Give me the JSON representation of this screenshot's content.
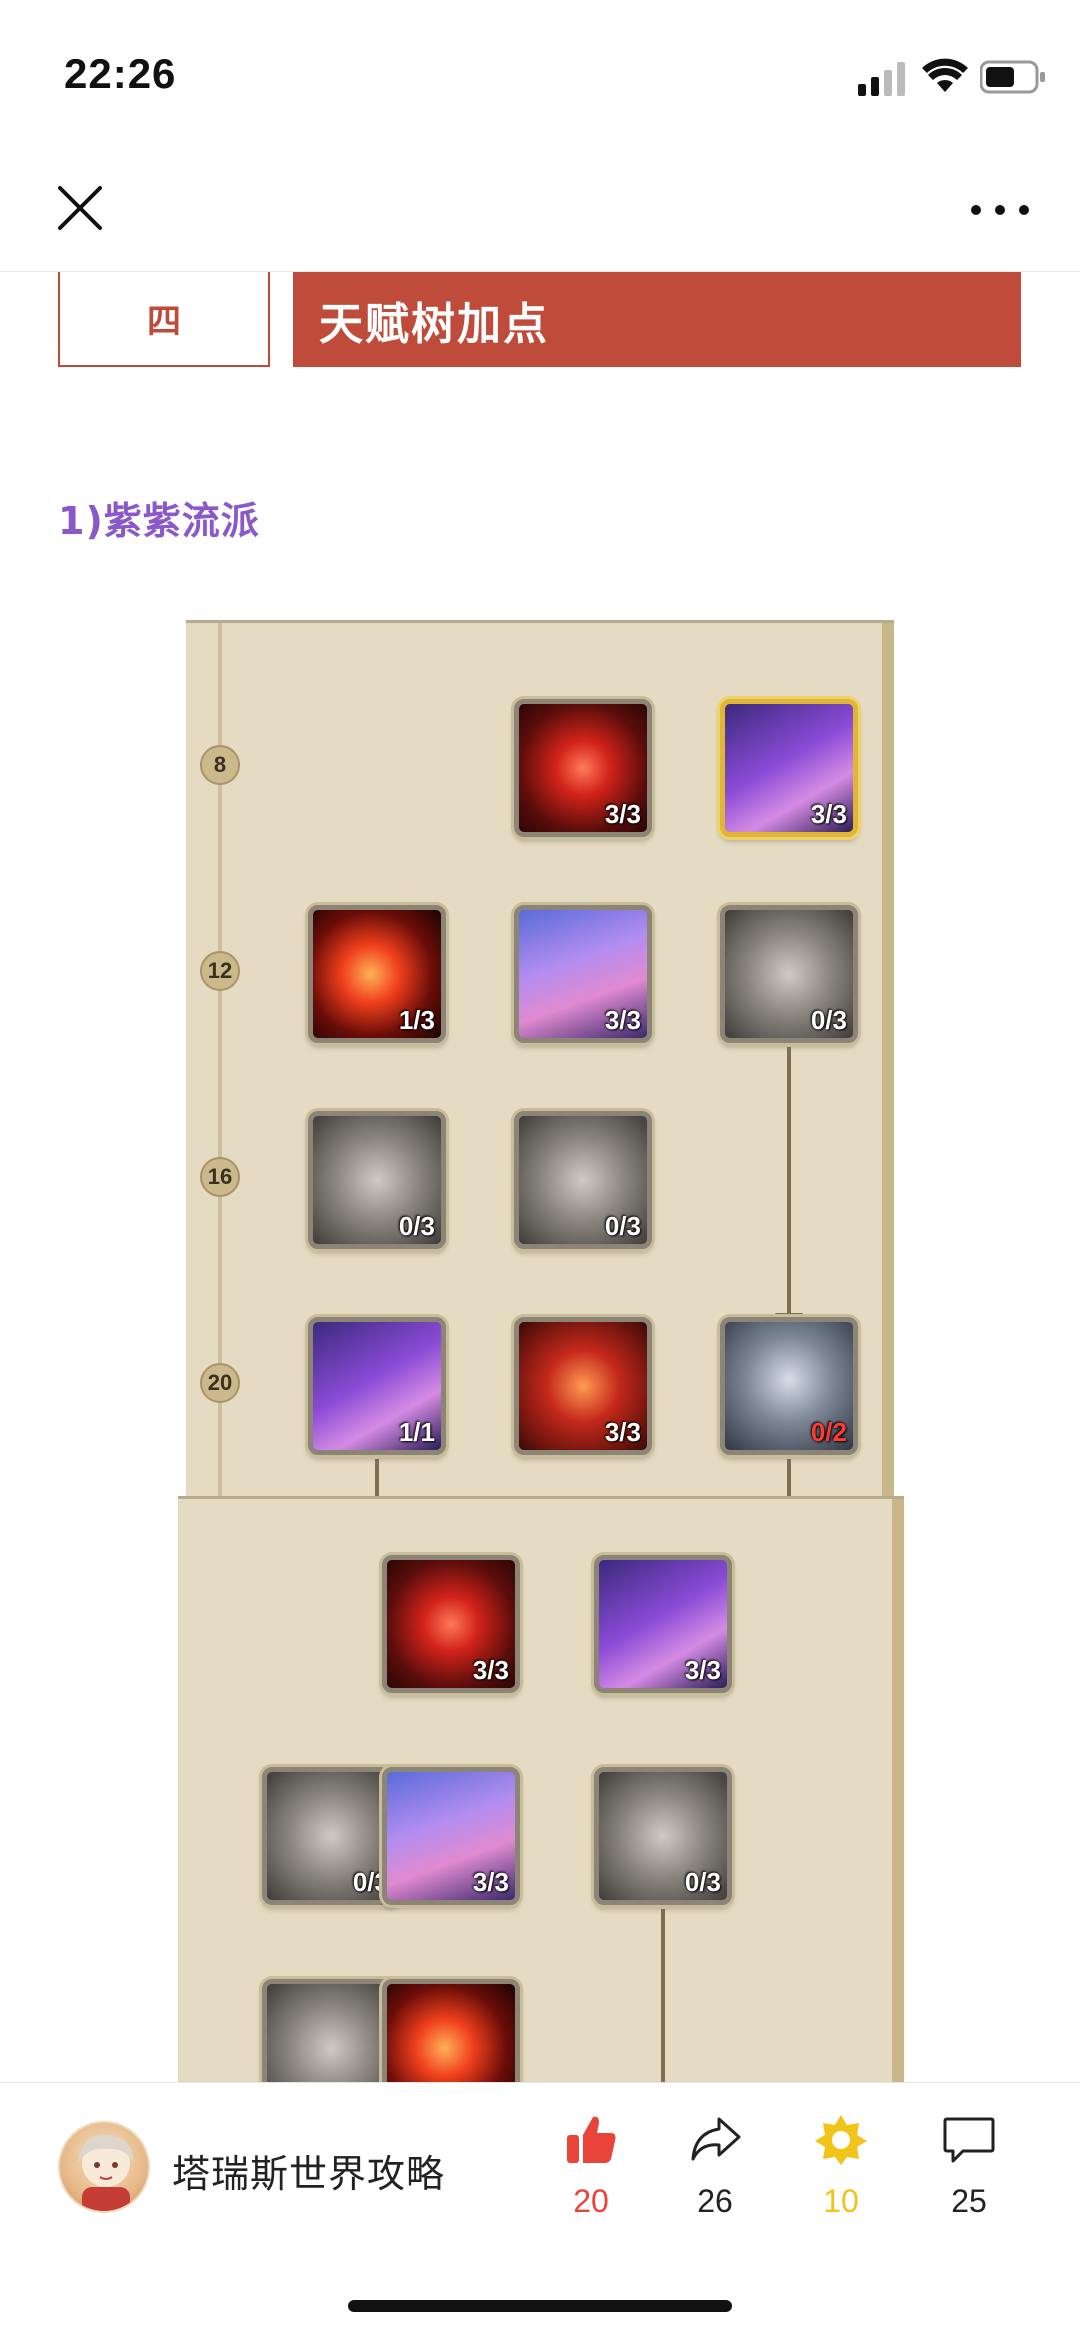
{
  "status": {
    "time": "22:26"
  },
  "section": {
    "number": "四",
    "title": "天赋树加点"
  },
  "subsection": {
    "title": "1)紫紫流派"
  },
  "talent_tree_1": {
    "levels": [
      "8",
      "12",
      "16",
      "20"
    ],
    "skills": [
      {
        "icon": "red-rune-icon",
        "count": "3/3"
      },
      {
        "icon": "harp-icon",
        "count": "3/3"
      },
      {
        "icon": "fire-ring-icon",
        "count": "1/3"
      },
      {
        "icon": "mage-silhouette-icon",
        "count": "3/3"
      },
      {
        "icon": "grey-harp-icon",
        "count": "0/3"
      },
      {
        "icon": "grey-swirl-icon",
        "count": "0/3"
      },
      {
        "icon": "grey-note-icon",
        "count": "0/3"
      },
      {
        "icon": "harp-icon",
        "count": "1/1"
      },
      {
        "icon": "dna-helix-icon",
        "count": "3/3"
      },
      {
        "icon": "hourglass-icon",
        "count": "0/2"
      }
    ]
  },
  "talent_tree_2": {
    "skills": [
      {
        "icon": "red-rune-icon",
        "count": "3/3"
      },
      {
        "icon": "harp-icon",
        "count": "3/3"
      },
      {
        "icon": "grey-fire-ring-icon",
        "count": "0/3"
      },
      {
        "icon": "mage-silhouette-icon",
        "count": "3/3"
      },
      {
        "icon": "grey-harp-icon",
        "count": "0/3"
      },
      {
        "icon": "grey-swirl-icon",
        "count": ""
      },
      {
        "icon": "fire-note-icon",
        "count": ""
      }
    ]
  },
  "bottom_bar": {
    "account_name": "塔瑞斯世界攻略",
    "like_count": "20",
    "share_count": "26",
    "star_count": "10",
    "comment_count": "25",
    "colors": {
      "like": "#e8443a",
      "star": "#f2c318"
    }
  }
}
